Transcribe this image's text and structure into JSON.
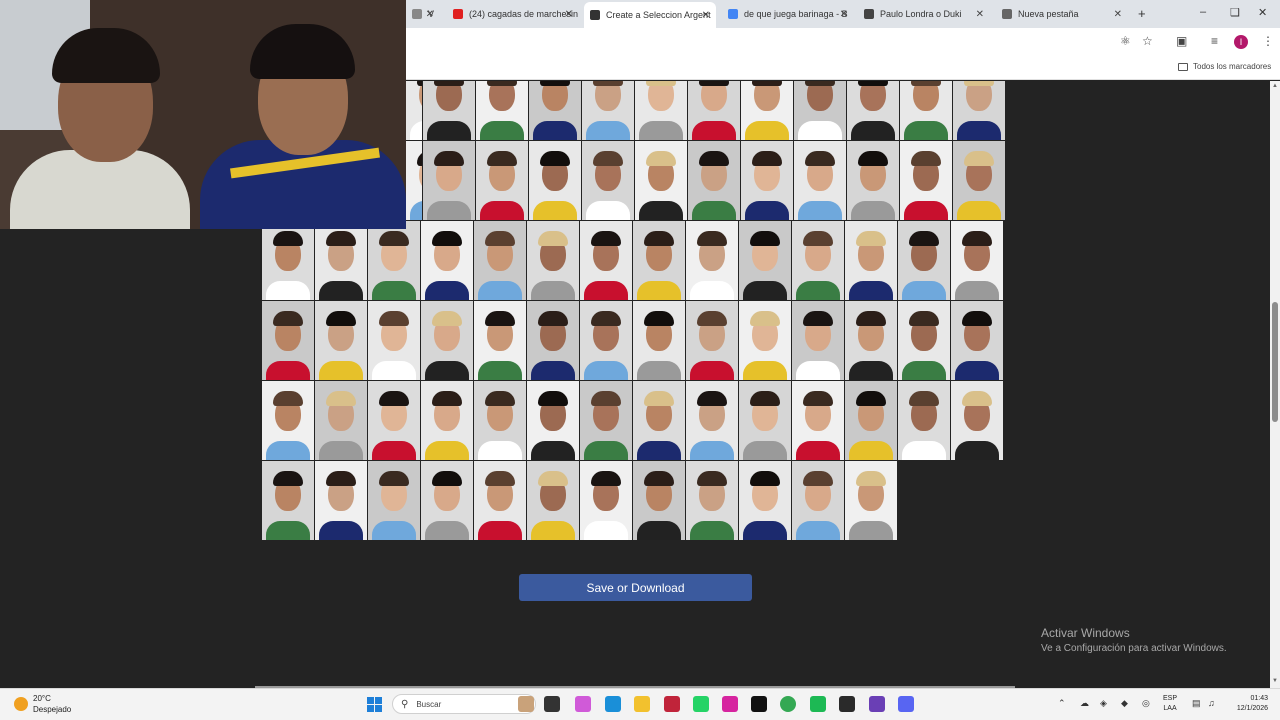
{
  "browser": {
    "tabs": [
      {
        "label": "V",
        "icon": "generic-icon",
        "color": "#888888",
        "active": false
      },
      {
        "label": "(24) cagadas de marchesin",
        "icon": "youtube-icon",
        "color": "#e02020",
        "active": false
      },
      {
        "label": "Create a Seleccion Argent",
        "icon": "page-icon",
        "color": "#333333",
        "active": true
      },
      {
        "label": "de que juega barinaga - B",
        "icon": "google-icon",
        "color": "#4285f4",
        "active": false
      },
      {
        "label": "Paulo Londra o Duki",
        "icon": "chatgpt-icon",
        "color": "#444444",
        "active": false
      },
      {
        "label": "Nueva pestaña",
        "icon": "chrome-icon",
        "color": "#666666",
        "active": false
      }
    ],
    "new_tab_symbol": "+",
    "bookmarks_all_label": "Todos los marcadores",
    "profile_initial": "I"
  },
  "page": {
    "save_button_label": "Save or Download",
    "watermark_title": "Activar Windows",
    "watermark_subtitle": "Ve a Configuración para activar Windows."
  },
  "taskbar": {
    "weather_temp": "20°C",
    "weather_desc": "Despejado",
    "search_placeholder": "Buscar",
    "lang_line1": "ESP",
    "lang_line2": "LAA",
    "time": "01:43",
    "date": "12/1/2026"
  },
  "colors": {
    "accent_button": "#3b5a9e",
    "page_bg": "#232323"
  }
}
